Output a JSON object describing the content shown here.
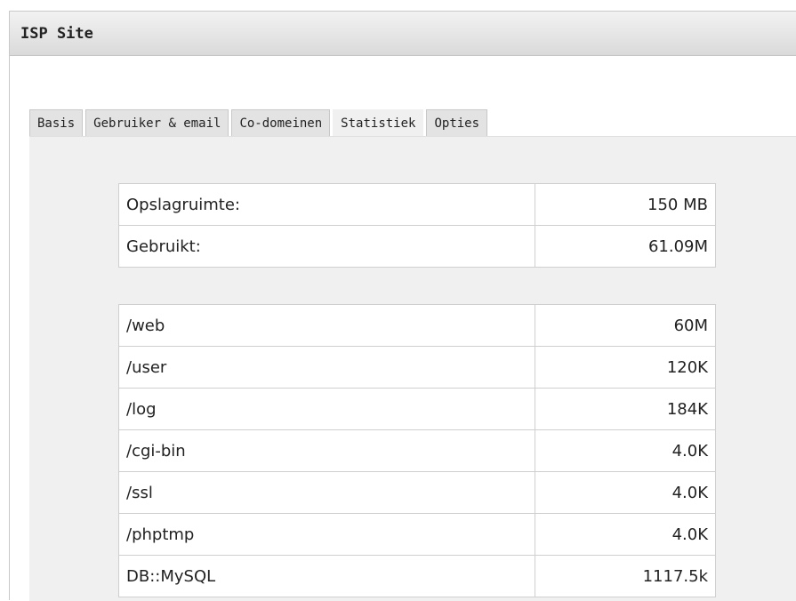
{
  "panel": {
    "title": "ISP Site"
  },
  "tabs": [
    {
      "label": "Basis"
    },
    {
      "label": "Gebruiker & email"
    },
    {
      "label": "Co-domeinen"
    },
    {
      "label": "Statistiek",
      "active": true
    },
    {
      "label": "Opties"
    }
  ],
  "quota": {
    "rows": [
      {
        "label": "Opslagruimte:",
        "value": "150 MB"
      },
      {
        "label": "Gebruikt:",
        "value": "61.09M"
      }
    ]
  },
  "usage": {
    "rows": [
      {
        "label": "/web",
        "value": "60M"
      },
      {
        "label": "/user",
        "value": "120K"
      },
      {
        "label": "/log",
        "value": "184K"
      },
      {
        "label": "/cgi-bin",
        "value": "4.0K"
      },
      {
        "label": "/ssl",
        "value": "4.0K"
      },
      {
        "label": "/phptmp",
        "value": "4.0K"
      },
      {
        "label": "DB::MySQL",
        "value": "1117.5k"
      }
    ]
  }
}
